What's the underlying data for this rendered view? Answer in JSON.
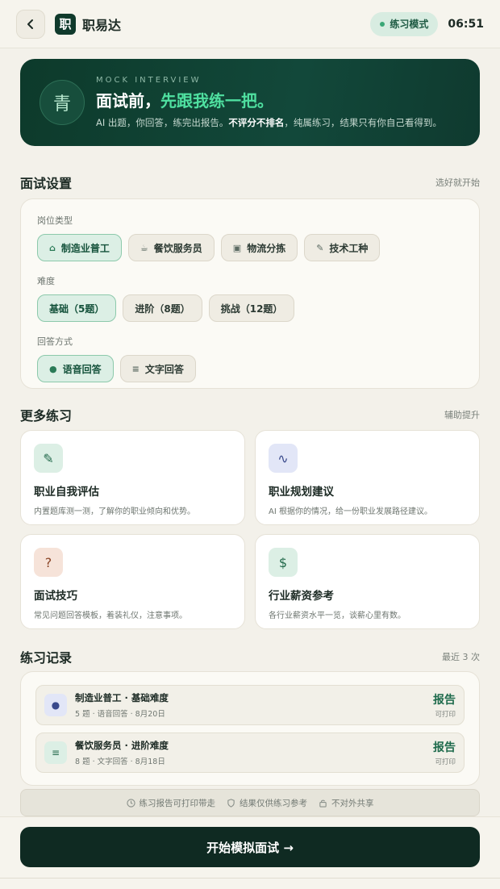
{
  "header": {
    "back_icon": "chevron-left-icon",
    "logo_char": "职",
    "app_name": "职易达",
    "mode_label": "练习模式",
    "time": "06:51"
  },
  "hero": {
    "badge_char": "青",
    "eyebrow": "MOCK INTERVIEW",
    "title_prefix": "面试前，",
    "title_accent": "先跟我练一把。",
    "desc_part1": "AI 出题，你回答，练完出报告。",
    "desc_bold": "不评分不排名",
    "desc_part2": "，纯属练习，结果只有你自己看得到。"
  },
  "settings": {
    "title": "面试设置",
    "hint": "选好就开始",
    "role_label": "岗位类型",
    "roles": [
      {
        "label": "制造业普工",
        "icon": "factory-icon",
        "glyph": "⌂"
      },
      {
        "label": "餐饮服务员",
        "icon": "cup-icon",
        "glyph": "☕"
      },
      {
        "label": "物流分拣",
        "icon": "box-icon",
        "glyph": "▣"
      },
      {
        "label": "技术工种",
        "icon": "wrench-icon",
        "glyph": "✎"
      }
    ],
    "difficulty_label": "难度",
    "difficulties": [
      "基础（5题）",
      "进阶（8题）",
      "挑战（12题）"
    ],
    "answer_label": "回答方式",
    "answers": [
      {
        "label": "语音回答",
        "icon": "mic-icon",
        "glyph": "●"
      },
      {
        "label": "文字回答",
        "icon": "text-icon",
        "glyph": "≡"
      }
    ]
  },
  "more": {
    "title": "更多练习",
    "hint": "辅助提升",
    "items": [
      {
        "title": "职业自我评估",
        "desc": "内置题库测一测，了解你的职业倾向和优势。",
        "icon": "pen-icon",
        "glyph": "✎",
        "bg": "#dcefe5",
        "fg": "#236a4c"
      },
      {
        "title": "职业规划建议",
        "desc": "AI 根据你的情况，给一份职业发展路径建议。",
        "icon": "pulse-icon",
        "glyph": "∿",
        "bg": "#e2e6f7",
        "fg": "#3a4a8c"
      },
      {
        "title": "面试技巧",
        "desc": "常见问题回答模板，着装礼仪，注意事项。",
        "icon": "help-circle-icon",
        "glyph": "?",
        "bg": "#f6e3d9",
        "fg": "#8a4426"
      },
      {
        "title": "行业薪资参考",
        "desc": "各行业薪资水平一览，谈薪心里有数。",
        "icon": "dollar-icon",
        "glyph": "$",
        "bg": "#dcefe5",
        "fg": "#236a4c"
      }
    ]
  },
  "records": {
    "title": "练习记录",
    "hint": "最近 3 次",
    "items": [
      {
        "title": "制造业普工 · 基础难度",
        "meta": "5 题 · 语音回答 · 8月20日",
        "report": "报告",
        "print": "可打印",
        "icon": "mic-icon",
        "glyph": "●",
        "bg": "#e2e6f7",
        "fg": "#3a4a8c"
      },
      {
        "title": "餐饮服务员 · 进阶难度",
        "meta": "8 题 · 文字回答 · 8月18日",
        "report": "报告",
        "print": "可打印",
        "icon": "text-icon",
        "glyph": "≡",
        "bg": "#dcefe5",
        "fg": "#236a4c"
      }
    ]
  },
  "notes": [
    "练习报告可打印带走",
    "结果仅供练习参考",
    "不对外共享"
  ],
  "cta": "开始模拟面试 →"
}
